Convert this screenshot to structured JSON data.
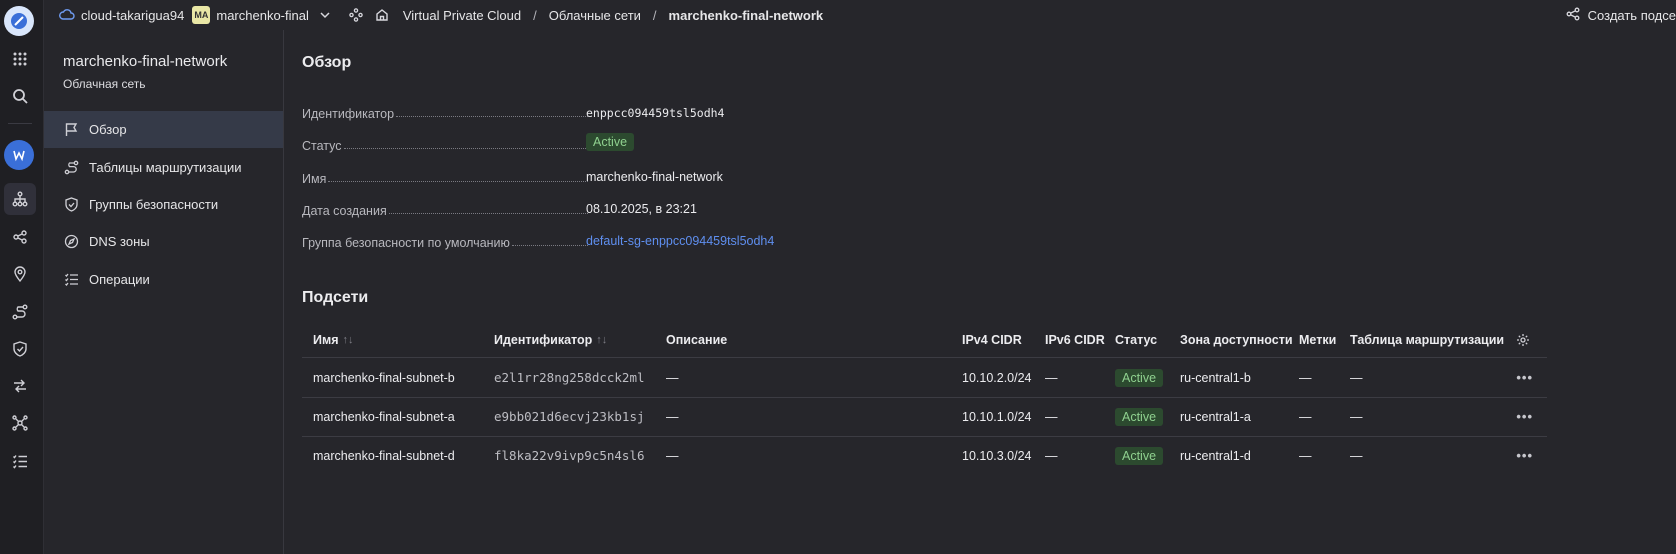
{
  "topbar": {
    "cloud": "cloud-takarigua94",
    "folder_badge": "MA",
    "folder": "marchenko-final",
    "crumbs": [
      "Virtual Private Cloud",
      "Облачные сети",
      "marchenko-final-network"
    ],
    "separator": "/",
    "create": "Создать подсе"
  },
  "nav": {
    "title": "marchenko-final-network",
    "subtitle": "Облачная сеть",
    "items": [
      {
        "label": "Обзор",
        "icon": "flag-icon"
      },
      {
        "label": "Таблицы маршрутизации",
        "icon": "route-icon"
      },
      {
        "label": "Группы безопасности",
        "icon": "shield-icon"
      },
      {
        "label": "DNS зоны",
        "icon": "compass-icon"
      },
      {
        "label": "Операции",
        "icon": "list-check-icon"
      }
    ]
  },
  "overview": {
    "heading": "Обзор",
    "props": [
      {
        "label": "Идентификатор",
        "value": "enppcc094459tsl5odh4"
      },
      {
        "label": "Статус",
        "value": "Active"
      },
      {
        "label": "Имя",
        "value": "marchenko-final-network"
      },
      {
        "label": "Дата создания",
        "value": "08.10.2025, в 23:21"
      },
      {
        "label": "Группа безопасности по умолчанию",
        "value": "default-sg-enppcc094459tsl5odh4"
      }
    ]
  },
  "subnets": {
    "heading": "Подсети",
    "columns": [
      "Имя",
      "Идентификатор",
      "Описание",
      "IPv4 CIDR",
      "IPv6 CIDR",
      "Статус",
      "Зона доступности",
      "Метки",
      "Таблица маршрутизации"
    ],
    "sort_glyph": "↑↓",
    "rows": [
      {
        "name": "marchenko-final-subnet-b",
        "id": "e2l1rr28ng258dcck2ml",
        "desc": "—",
        "ipv4": "10.10.2.0/24",
        "ipv6": "—",
        "status": "Active",
        "zone": "ru-central1-b",
        "labels": "—",
        "route": "—",
        "menu": "•••"
      },
      {
        "name": "marchenko-final-subnet-a",
        "id": "e9bb021d6ecvj23kb1sj",
        "desc": "—",
        "ipv4": "10.10.1.0/24",
        "ipv6": "—",
        "status": "Active",
        "zone": "ru-central1-a",
        "labels": "—",
        "route": "—",
        "menu": "•••"
      },
      {
        "name": "marchenko-final-subnet-d",
        "id": "fl8ka22v9ivp9c5n4sl6",
        "desc": "—",
        "ipv4": "10.10.3.0/24",
        "ipv6": "—",
        "status": "Active",
        "zone": "ru-central1-d",
        "labels": "—",
        "route": "—",
        "menu": "•••"
      }
    ]
  },
  "colors": {
    "accent": "#3a6fd8",
    "link": "#5f8ff0",
    "status_bg": "#2c4a2f",
    "status_fg": "#8fd18f"
  }
}
